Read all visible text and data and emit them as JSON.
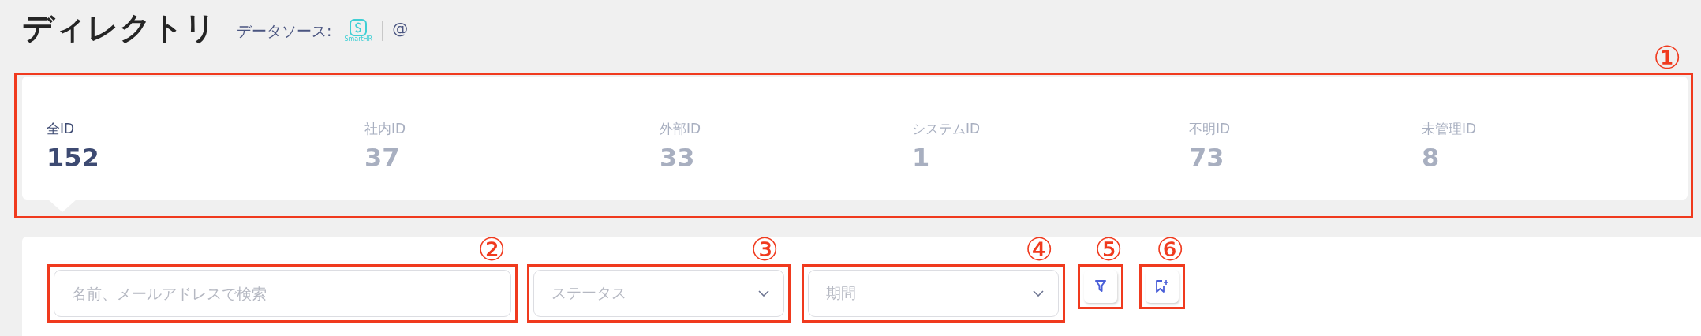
{
  "header": {
    "title": "ディレクトリ",
    "source_label": "データソース:",
    "source_logo_text": "SmartHR",
    "source_account": "@"
  },
  "stats": [
    {
      "label": "全ID",
      "value": "152",
      "selected": true
    },
    {
      "label": "社内ID",
      "value": "37",
      "selected": false
    },
    {
      "label": "外部ID",
      "value": "33",
      "selected": false
    },
    {
      "label": "システムID",
      "value": "1",
      "selected": false
    },
    {
      "label": "不明ID",
      "value": "73",
      "selected": false
    },
    {
      "label": "未管理ID",
      "value": "8",
      "selected": false
    }
  ],
  "filters": {
    "search": {
      "placeholder": "名前、メールアドレスで検索"
    },
    "status": {
      "placeholder": "ステータス"
    },
    "period": {
      "placeholder": "期間"
    }
  },
  "annotations": [
    "①",
    "②",
    "③",
    "④",
    "⑤",
    "⑥"
  ]
}
